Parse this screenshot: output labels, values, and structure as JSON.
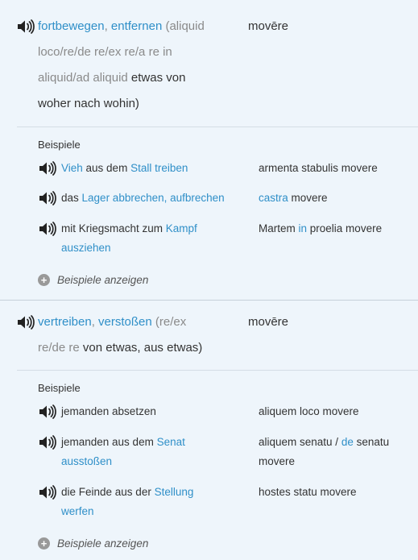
{
  "entries": [
    {
      "headword_parts": [
        {
          "text": "fortbewegen",
          "style": "blue"
        },
        {
          "text": ", ",
          "style": "grey"
        },
        {
          "text": "entfernen",
          "style": "blue"
        },
        {
          "text": " (aliquid loco/re/de re/ex re/a re in aliquid/ad aliquid ",
          "style": "grey"
        },
        {
          "text": "etwas von woher nach wohin)",
          "style": "dark"
        }
      ],
      "translation": "movēre",
      "examples_title": "Beispiele",
      "examples": [
        {
          "de": [
            {
              "text": "Vieh",
              "style": "blue"
            },
            {
              "text": " aus dem ",
              "style": "dark"
            },
            {
              "text": "Stall treiben",
              "style": "blue"
            }
          ],
          "la": [
            {
              "text": "armenta stabulis movere",
              "style": "dark"
            }
          ]
        },
        {
          "de": [
            {
              "text": "das ",
              "style": "dark"
            },
            {
              "text": "Lager abbrechen, aufbrechen",
              "style": "blue"
            }
          ],
          "la": [
            {
              "text": "castra",
              "style": "blue"
            },
            {
              "text": " movere",
              "style": "dark"
            }
          ]
        },
        {
          "de": [
            {
              "text": "mit Kriegsmacht zum ",
              "style": "dark"
            },
            {
              "text": "Kampf ausziehen",
              "style": "blue"
            }
          ],
          "la": [
            {
              "text": "Martem ",
              "style": "dark"
            },
            {
              "text": "in",
              "style": "blue"
            },
            {
              "text": " proelia movere",
              "style": "dark"
            }
          ]
        }
      ],
      "show_more_label": "Beispiele anzeigen"
    },
    {
      "headword_parts": [
        {
          "text": "vertreiben",
          "style": "blue"
        },
        {
          "text": ", ",
          "style": "grey"
        },
        {
          "text": "verstoßen",
          "style": "blue"
        },
        {
          "text": " (re/ex re/de re ",
          "style": "grey"
        },
        {
          "text": "von etwas, aus etwas)",
          "style": "dark"
        }
      ],
      "translation": "movēre",
      "examples_title": "Beispiele",
      "examples": [
        {
          "de": [
            {
              "text": "jemanden absetzen",
              "style": "dark"
            }
          ],
          "la": [
            {
              "text": "aliquem loco movere",
              "style": "dark"
            }
          ]
        },
        {
          "de": [
            {
              "text": "jemanden aus dem ",
              "style": "dark"
            },
            {
              "text": "Senat ausstoßen",
              "style": "blue"
            }
          ],
          "la": [
            {
              "text": "aliquem senatu / ",
              "style": "dark"
            },
            {
              "text": "de",
              "style": "blue"
            },
            {
              "text": " senatu movere",
              "style": "dark"
            }
          ]
        },
        {
          "de": [
            {
              "text": "die Feinde aus der ",
              "style": "dark"
            },
            {
              "text": "Stellung werfen",
              "style": "blue"
            }
          ],
          "la": [
            {
              "text": "hostes statu movere",
              "style": "dark"
            }
          ]
        }
      ],
      "show_more_label": "Beispiele anzeigen"
    }
  ],
  "colors": {
    "link": "#2f8fc8",
    "muted": "#8a8a8a",
    "text": "#333333",
    "background": "#eef5fb"
  },
  "icons": {
    "audio": "speaker-icon",
    "expand": "plus-circle-icon"
  }
}
